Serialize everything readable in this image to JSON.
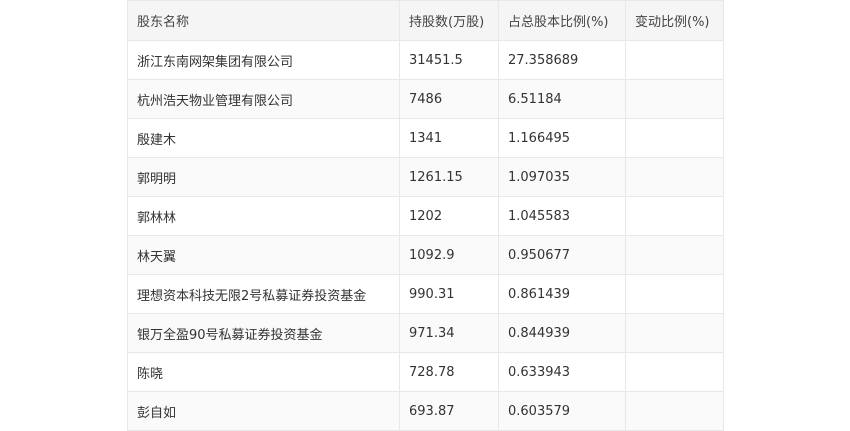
{
  "table": {
    "headers": [
      "股东名称",
      "持股数(万股)",
      "占总股本比例(%)",
      "变动比例(%)"
    ],
    "rows": [
      [
        "浙江东南网架集团有限公司",
        "31451.5",
        "27.358689",
        ""
      ],
      [
        "杭州浩天物业管理有限公司",
        "7486",
        "6.51184",
        ""
      ],
      [
        "殷建木",
        "1341",
        "1.166495",
        ""
      ],
      [
        "郭明明",
        "1261.15",
        "1.097035",
        ""
      ],
      [
        "郭林林",
        "1202",
        "1.045583",
        ""
      ],
      [
        "林天翼",
        "1092.9",
        "0.950677",
        ""
      ],
      [
        "理想资本科技无限2号私募证券投资基金",
        "990.31",
        "0.861439",
        ""
      ],
      [
        "银万全盈90号私募证券投资基金",
        "971.34",
        "0.844939",
        ""
      ],
      [
        "陈晓",
        "728.78",
        "0.633943",
        ""
      ],
      [
        "彭自如",
        "693.87",
        "0.603579",
        ""
      ]
    ]
  }
}
